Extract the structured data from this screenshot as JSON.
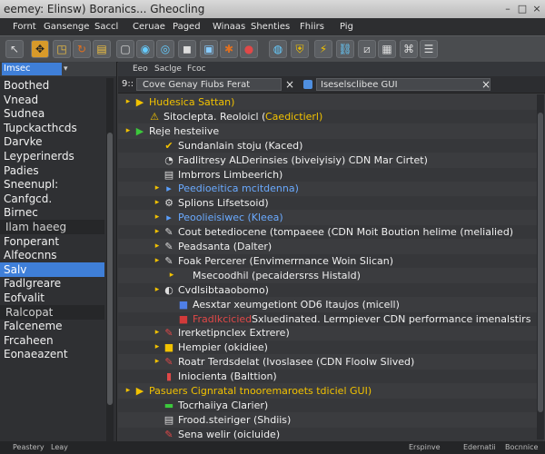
{
  "window": {
    "title": "eemey: Elinsw) Boranics... Gheocling",
    "minimize_glyph": "–",
    "maximize_glyph": "□",
    "close_glyph": "×"
  },
  "menu": [
    "Fornt",
    "Gansenge",
    "Saccl",
    "Ceruae",
    "Paged",
    "Winaas",
    "Shenties",
    "Fhiirs",
    "Pig"
  ],
  "sidebar": {
    "selector_label": "Imsec",
    "selector_arrow": "▾",
    "items": [
      {
        "label": "Boothed",
        "style": "normal"
      },
      {
        "label": "Vnead",
        "style": "normal"
      },
      {
        "label": "Sudnea",
        "style": "normal"
      },
      {
        "label": "Tupckacthcds",
        "style": "normal"
      },
      {
        "label": "Darvke",
        "style": "normal"
      },
      {
        "label": "Leyperinerds",
        "style": "normal"
      },
      {
        "label": "Padies",
        "style": "normal"
      },
      {
        "label": "Sneenupl:",
        "style": "normal"
      },
      {
        "label": "Canfgcd.",
        "style": "normal"
      },
      {
        "label": "Birnec",
        "style": "normal"
      },
      {
        "label": "Ilam haeeg",
        "style": "group"
      },
      {
        "label": "Fonperant",
        "style": "normal"
      },
      {
        "label": "Alfeocnns",
        "style": "normal"
      },
      {
        "label": "Salv",
        "style": "active"
      },
      {
        "label": "Fadlgreare",
        "style": "normal"
      },
      {
        "label": "Eofvalit",
        "style": "normal"
      },
      {
        "label": "Ralcopat",
        "style": "group"
      },
      {
        "label": "Falceneme",
        "style": "normal"
      },
      {
        "label": "Frcaheen",
        "style": "normal"
      },
      {
        "label": "Eonaeazent",
        "style": "normal"
      }
    ]
  },
  "tabs": [
    "Eeo",
    "Saclge",
    "Fcoc"
  ],
  "pathbar": {
    "prefix": "9::",
    "crumb": "Cove Genay Fiubs Ferat",
    "close_glyph": "×",
    "field": "Iseselsclibee GUI",
    "field_close_glyph": "×"
  },
  "tree": [
    {
      "indent": 0,
      "arrow": "▸",
      "icon": "▶",
      "icon_color": "#f2c200",
      "text": "Hudesica Sattan)",
      "color": "#f2c200"
    },
    {
      "indent": 1,
      "arrow": "",
      "icon": "⚠",
      "icon_color": "#f2c200",
      "text": "Sitoclepta. Reoloicl (",
      "text2": "Caedictierl)",
      "color": "#f0f0f0",
      "color2": "#f2c200"
    },
    {
      "indent": 0,
      "arrow": "▸",
      "icon": "▶",
      "icon_color": "#3cc83c",
      "text": "Reje hesteiive",
      "color": "#f0f0f0"
    },
    {
      "indent": 2,
      "arrow": "",
      "icon": "✔",
      "icon_color": "#f2c200",
      "text": "Sundanlain stoju (Kaced)",
      "color": "#f0f0f0"
    },
    {
      "indent": 2,
      "arrow": "",
      "icon": "◔",
      "icon_color": "#dddddd",
      "text": "Fadlitresy ALDerinsies (biveiyisiy) CDN Mar Cirtet)",
      "color": "#f0f0f0"
    },
    {
      "indent": 2,
      "arrow": "",
      "icon": "▤",
      "icon_color": "#dddddd",
      "text": "Imbrrors Limbeerich)",
      "color": "#f0f0f0"
    },
    {
      "indent": 2,
      "arrow": "▸",
      "icon": "▸",
      "icon_color": "#5aa0ff",
      "text": "Peedioeitica mcitdenna)",
      "color": "#6aaaff"
    },
    {
      "indent": 2,
      "arrow": "▸",
      "icon": "⚙",
      "icon_color": "#dddddd",
      "text": "Splions Lifsetsoid)",
      "color": "#f0f0f0"
    },
    {
      "indent": 2,
      "arrow": "▸",
      "icon": "▸",
      "icon_color": "#5aa0ff",
      "text": "Peoolieisiwec (Kleea)",
      "color": "#6aaaff"
    },
    {
      "indent": 2,
      "arrow": "▸",
      "icon": "✎",
      "icon_color": "#dddddd",
      "text": "Cout betediocene (tompaeee (CDN Moit Boution helime (melialied)",
      "color": "#f0f0f0"
    },
    {
      "indent": 2,
      "arrow": "▸",
      "icon": "✎",
      "icon_color": "#dddddd",
      "text": "Peadsanta (Dalter)",
      "color": "#f0f0f0"
    },
    {
      "indent": 2,
      "arrow": "▸",
      "icon": "✎",
      "icon_color": "#dddddd",
      "text": "Foak Percerer (Envimerrnance Woin Slican)",
      "color": "#f0f0f0"
    },
    {
      "indent": 3,
      "arrow": "▸",
      "icon": "",
      "icon_color": "#dddddd",
      "text": "Msecoodhil (pecaidersrss Histald)",
      "color": "#f0f0f0"
    },
    {
      "indent": 2,
      "arrow": "▸",
      "icon": "◐",
      "icon_color": "#dddddd",
      "text": "Cvdlsibtaaobomo)",
      "color": "#f0f0f0"
    },
    {
      "indent": 3,
      "arrow": "",
      "icon": "■",
      "icon_color": "#4f7fe8",
      "text": "Aesxtar xeumgetiont OD6 Itaujos (micell)",
      "color": "#f0f0f0"
    },
    {
      "indent": 3,
      "arrow": "",
      "icon": "■",
      "icon_color": "#d23a3a",
      "text": "Fradlkcicied",
      "text2": " Sxluedinated. Lermpiever CDN performance imenalstirs",
      "color": "#e04848",
      "color2": "#f0f0f0"
    },
    {
      "indent": 2,
      "arrow": "▸",
      "icon": "✎",
      "icon_color": "#e04848",
      "text": "Irerketipnclex Extrere)",
      "color": "#f0f0f0"
    },
    {
      "indent": 2,
      "arrow": "▸",
      "icon": "■",
      "icon_color": "#f2c200",
      "text": "Hempier (okidiee)",
      "color": "#f0f0f0"
    },
    {
      "indent": 2,
      "arrow": "▸",
      "icon": "✎",
      "icon_color": "#e04848",
      "text": "Roatr Terdsdelat (Ivoslasee (CDN Floolw Slived)",
      "color": "#f0f0f0"
    },
    {
      "indent": 2,
      "arrow": "",
      "icon": "▮",
      "icon_color": "#e04848",
      "text": "Iniocienta (Balttion)",
      "color": "#f0f0f0"
    },
    {
      "indent": 0,
      "arrow": "▸",
      "icon": "▶",
      "icon_color": "#f2c200",
      "text": "Pasuers Cignratal tnooremaroets tdiciel GUI)",
      "color": "#f2c200"
    },
    {
      "indent": 2,
      "arrow": "",
      "icon": "▬",
      "icon_color": "#3cc83c",
      "text": "Tocrhaiiya Clarier)",
      "color": "#f0f0f0"
    },
    {
      "indent": 2,
      "arrow": "",
      "icon": "▤",
      "icon_color": "#dddddd",
      "text": "Frood.steiriger (Shdiis)",
      "color": "#f0f0f0"
    },
    {
      "indent": 2,
      "arrow": "",
      "icon": "✎",
      "icon_color": "#e04848",
      "text": "Sena welir (oicluide)",
      "color": "#f0f0f0"
    }
  ],
  "status": {
    "left": "Peastery",
    "left2": "Leay",
    "right1": "Erspinve",
    "right2": "Edernatii",
    "right3": "Bocnnice"
  },
  "colors": {
    "accent": "#3f7fd8",
    "yellow": "#f2c200",
    "green": "#3cc83c",
    "red": "#e04848"
  }
}
